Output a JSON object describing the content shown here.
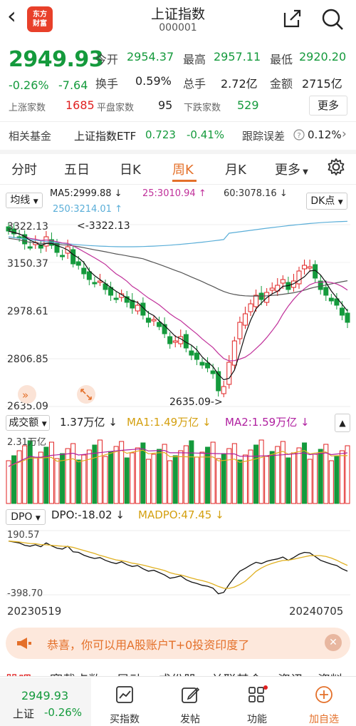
{
  "header": {
    "back_icon": "chevron-left-icon",
    "logo_text": "东方财富",
    "title": "上证指数",
    "code": "000001",
    "share_icon": "share-icon",
    "search_icon": "search-icon"
  },
  "quote": {
    "price": "2949.93",
    "change_pct": "-0.26%",
    "change": "-7.64",
    "open_label": "今开",
    "open": "2954.37",
    "high_label": "最高",
    "high": "2957.11",
    "low_label": "最低",
    "low": "2920.20",
    "turnover_label": "换手",
    "turnover": "0.59%",
    "volume_label": "总手",
    "volume": "2.72亿",
    "amount_label": "金额",
    "amount": "2715亿",
    "up_label": "上涨家数",
    "up": "1685",
    "flat_label": "平盘家数",
    "flat": "95",
    "down_label": "下跌家数",
    "down": "529",
    "more_label": "更多"
  },
  "fund": {
    "label": "相关基金",
    "name": "上证指数ETF",
    "price": "0.723",
    "pct": "-0.41%",
    "track_label": "跟踪误差",
    "track_value": "0.12%"
  },
  "tabs": [
    "分时",
    "五日",
    "日K",
    "周K",
    "月K",
    "更多"
  ],
  "active_tab": "周K",
  "chart": {
    "ma_select": "均线",
    "ma5": "MA5:2999.88",
    "ma25": "25:3010.94",
    "ma60": "60:3078.16",
    "ma250": "250:3214.01",
    "dk_label": "DK点",
    "y_labels": [
      "3322.13",
      "3150.37",
      "2978.61",
      "2806.85",
      "2635.09"
    ],
    "max_annot": "<-3322.13",
    "min_annot": "2635.09->",
    "vol_select": "成交额",
    "vol_value": "1.37万亿",
    "vol_ma1": "MA1:1.49万亿",
    "vol_ma2": "MA2:1.59万亿",
    "vol_top": "2.31万亿",
    "dpo_select": "DPO",
    "dpo_value": "DPO:-18.02",
    "madpo_value": "MADPO:47.45",
    "dpo_top": "190.57",
    "dpo_bottom": "-398.70",
    "date_start": "20230519",
    "date_end": "20240705"
  },
  "colors": {
    "up": "#e02020",
    "down": "#149a3c",
    "ma5": "#222222",
    "ma25": "#c0309a",
    "ma60": "#555555",
    "ma250": "#5aaed8",
    "accent": "#e4702a"
  },
  "banner": {
    "icon": "megaphone-icon",
    "text": "恭喜，你可以用A股账户T+0投资印度了",
    "close_icon": "close-icon"
  },
  "bottom_tabs_partial": [
    "股吧",
    "赛载点数",
    "异动",
    "成份股",
    "关联基金",
    "资讯",
    "资料"
  ],
  "bottom_nav": {
    "index_name": "上证",
    "price": "2949.93",
    "pct": "-0.26%",
    "items": [
      {
        "label": "买指数",
        "icon": "chart-icon"
      },
      {
        "label": "发帖",
        "icon": "edit-icon"
      },
      {
        "label": "功能",
        "icon": "grid-icon"
      },
      {
        "label": "加自选",
        "icon": "plus-circle-icon"
      }
    ]
  }
}
